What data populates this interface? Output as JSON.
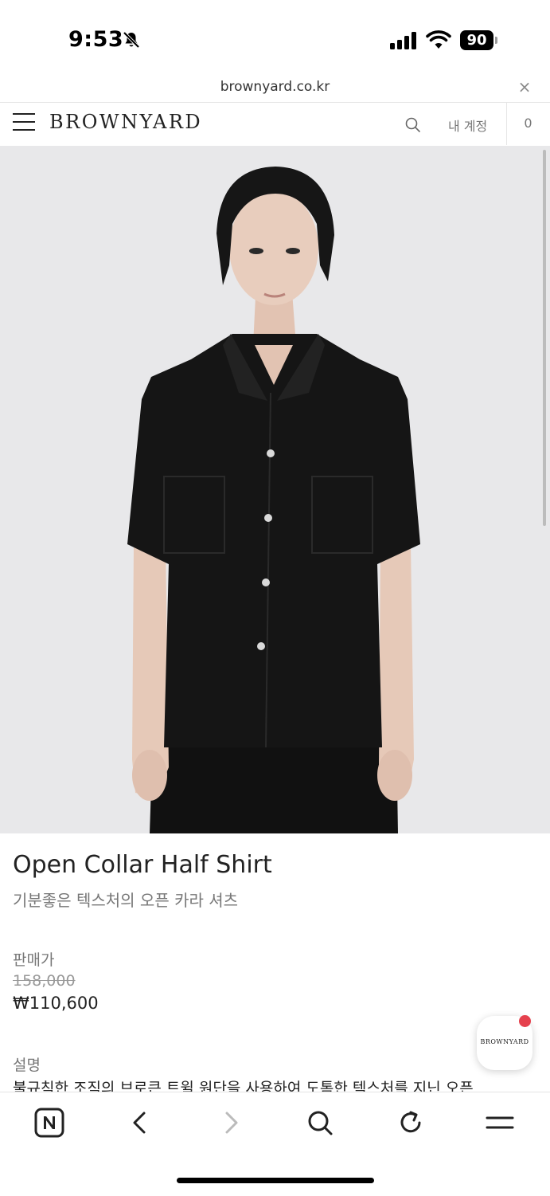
{
  "status_bar": {
    "time": "9:53",
    "battery": "90",
    "icons": [
      "bell-slash-icon",
      "signal-icon",
      "wifi-icon",
      "battery-icon"
    ]
  },
  "browser": {
    "url": "brownyard.co.kr",
    "close_label": "×"
  },
  "header": {
    "logo": "BROWNYARD",
    "account_label": "내 계정",
    "cart_count": "0",
    "icons": [
      "menu-icon",
      "search-icon"
    ]
  },
  "product": {
    "name": "Open Collar Half Shirt",
    "subtitle": "기분좋은 텍스처의 오픈 카라 셔츠",
    "price_label": "판매가",
    "original_price": "158,000",
    "sale_price": "₩110,600",
    "description_label": "설명",
    "description_text": "불규칙한 조직의 브로큰 트윌 원단을 사용하여 도톰한 텍스처를 지닌 오픈"
  },
  "chat_button": {
    "label": "BROWNYARD",
    "badge_color": "#e5414d"
  },
  "bottom_bar": {
    "items": [
      "naver-home-icon",
      "back-icon",
      "forward-icon",
      "search-icon",
      "reload-icon",
      "menu-icon"
    ]
  },
  "colors": {
    "hero_background": "#e8e8ea",
    "text": "#222222",
    "muted": "#777777"
  }
}
